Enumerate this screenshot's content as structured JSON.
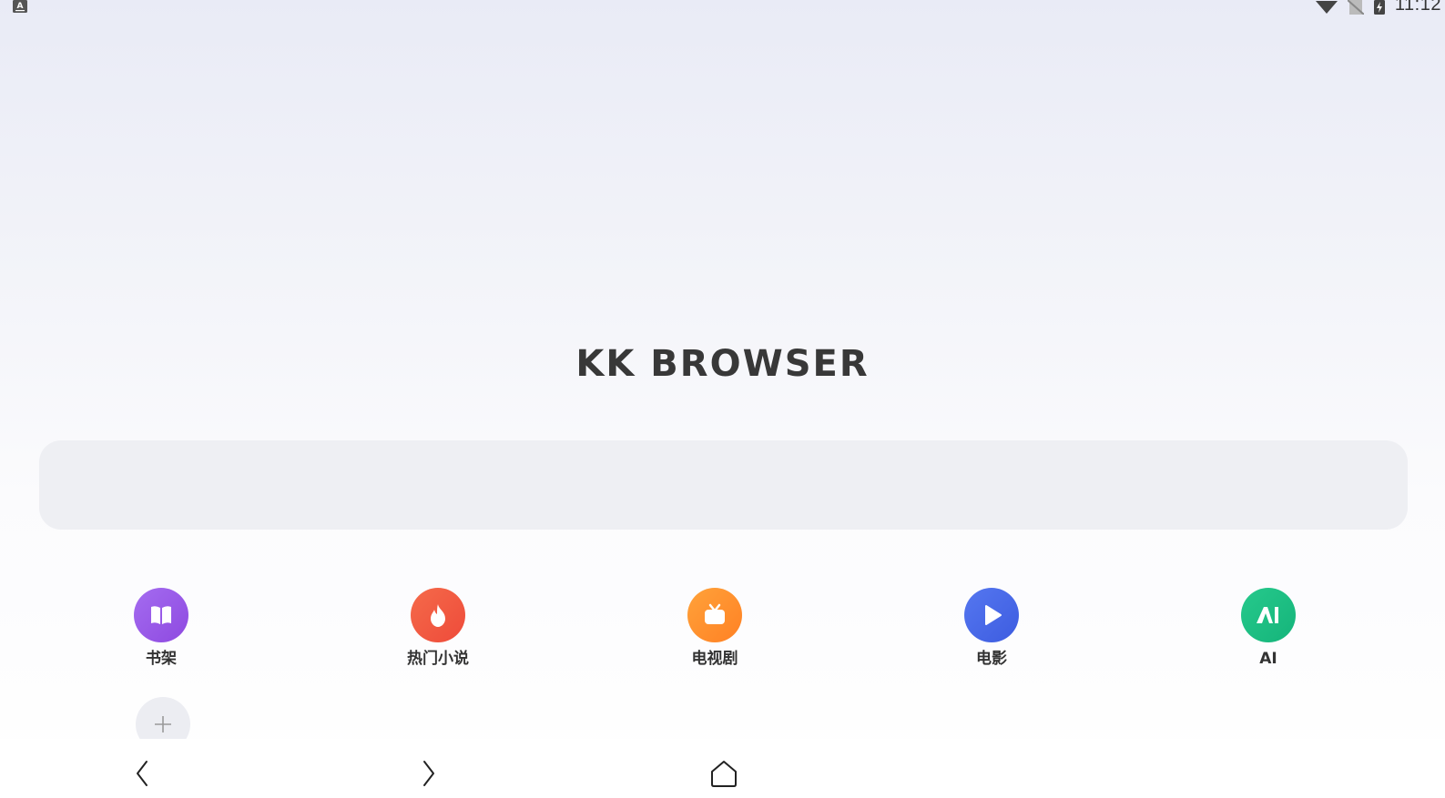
{
  "status_bar": {
    "time": "11:12",
    "icons": [
      "keyboard-a-icon",
      "wifi-icon",
      "no-sim-icon",
      "battery-charging-icon"
    ]
  },
  "brand": {
    "title": "KK BROWSER"
  },
  "search": {
    "placeholder": ""
  },
  "shortcuts": [
    {
      "label": "书架",
      "icon": "bookshelf-icon",
      "color": "#9b59e6"
    },
    {
      "label": "热门小说",
      "icon": "fire-icon",
      "color": "#f2543f"
    },
    {
      "label": "电视剧",
      "icon": "tv-icon",
      "color": "#ff8c2a"
    },
    {
      "label": "电影",
      "icon": "play-icon",
      "color": "#4a68ea"
    },
    {
      "label": "AI",
      "icon": "ai-icon",
      "color": "#1fbf85"
    }
  ],
  "add_shortcut": {
    "icon": "plus-icon"
  },
  "bottom_nav": {
    "items": [
      "back-icon",
      "forward-icon",
      "home-icon"
    ]
  }
}
